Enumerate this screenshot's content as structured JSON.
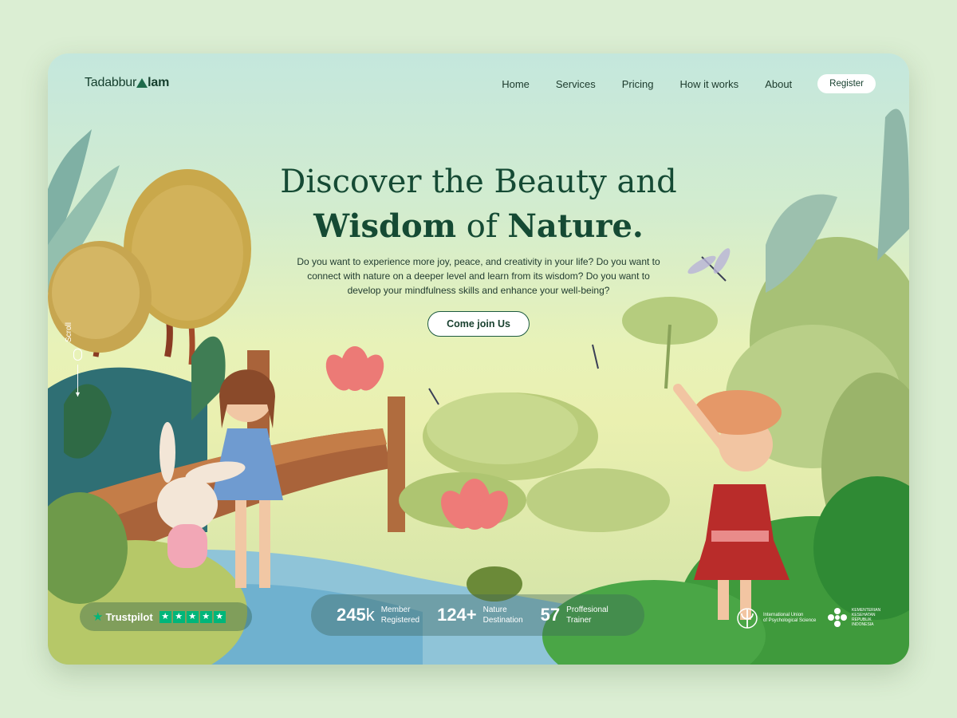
{
  "brand": {
    "logo_text_left": "Tadabbur",
    "logo_text_right": "lam"
  },
  "nav": {
    "items": [
      "Home",
      "Services",
      "Pricing",
      "How it works",
      "About"
    ],
    "register_label": "Register"
  },
  "hero": {
    "title_line1": "Discover the Beauty and",
    "title_bold1": "Wisdom",
    "title_mid": " of ",
    "title_bold2": "Nature.",
    "description": "Do you want to experience more joy, peace, and creativity in your life? Do you want to connect with nature on a deeper level and learn from its wisdom? Do you want to develop your mindfulness skills and enhance your well-being?",
    "cta_label": "Come join Us"
  },
  "scroll": {
    "label": "Scroll"
  },
  "trustpilot": {
    "name": "Trustpilot",
    "stars": 5
  },
  "stats": [
    {
      "value": "245",
      "unit": "k",
      "line1": "Member",
      "line2": "Registered"
    },
    {
      "value": "124+",
      "unit": "",
      "line1": "Nature",
      "line2": "Destination"
    },
    {
      "value": "57",
      "unit": "",
      "line1": "Proffesional",
      "line2": "Trainer"
    }
  ],
  "partners": [
    {
      "name_line1": "International Union",
      "name_line2": "of Psychological Science",
      "icon": "psi-emblem-icon"
    },
    {
      "name_line1": "KEMENTERIAN",
      "name_line2": "KESEHATAN",
      "name_line3": "REPUBLIK",
      "name_line4": "INDONESIA",
      "icon": "health-ministry-icon"
    }
  ],
  "colors": {
    "brand_green": "#154a34",
    "trustpilot_green": "#00b67a",
    "background": "#dbeed3"
  }
}
